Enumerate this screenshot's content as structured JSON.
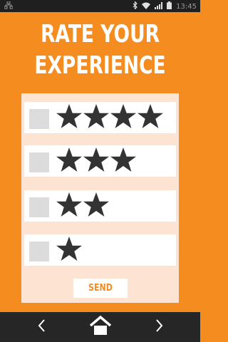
{
  "status_bar": {
    "time": "13:45",
    "icons": [
      "network-icon",
      "bluetooth-icon",
      "wifi-icon",
      "signal-icon",
      "battery-icon"
    ]
  },
  "title": {
    "line1": "RATE YOUR",
    "line2": "EXPERIENCE"
  },
  "rating_options": [
    {
      "stars": 4
    },
    {
      "stars": 3
    },
    {
      "stars": 2
    },
    {
      "stars": 1
    }
  ],
  "send_label": "SEND",
  "nav_bar": {
    "icons": [
      "back-chevron-icon",
      "home-icon",
      "forward-chevron-icon"
    ]
  },
  "colors": {
    "background": "#f58c1f",
    "card": "#fde3d1",
    "star": "#333333",
    "status_bar": "#1f1f1f",
    "nav_bar": "#262626"
  }
}
